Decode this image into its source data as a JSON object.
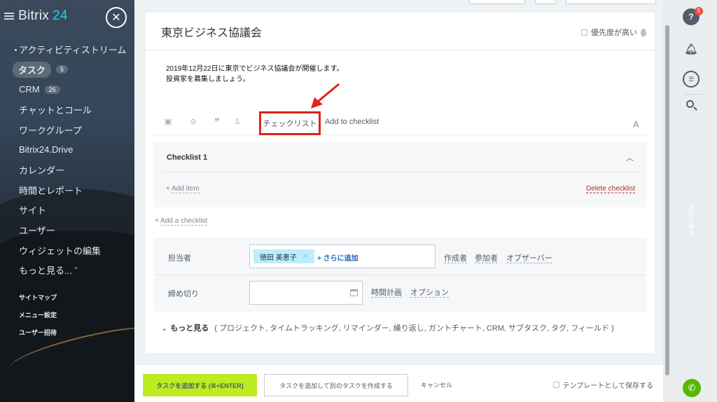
{
  "sidebar": {
    "logo_text": "Bitrix",
    "logo_num": "24",
    "close_glyph": "✕",
    "items": [
      {
        "label": "アクティビティストリーム"
      },
      {
        "label": "タスク",
        "count": "5"
      },
      {
        "label": "CRM",
        "count": "26"
      },
      {
        "label": "チャットとコール"
      },
      {
        "label": "ワークグループ"
      },
      {
        "label": "Bitrix24.Drive"
      },
      {
        "label": "カレンダー"
      },
      {
        "label": "時間とレポート"
      },
      {
        "label": "サイト"
      },
      {
        "label": "ユーザー"
      },
      {
        "label": "ウィジェットの編集"
      },
      {
        "label": "もっと見る... ˇ"
      }
    ],
    "footer_links": [
      "サイトマップ",
      "メニュー設定",
      "ユーザー招待"
    ]
  },
  "task": {
    "title": "東京ビジネス協議会",
    "priority_label": "優先度が高い",
    "description_line1": "2019年12月22日に東京でビジネス協議会が開催します。",
    "description_line2": "投資家を募集しましょう。"
  },
  "toolbar": {
    "checklist_label": "チェックリスト",
    "add_to_checklist": "Add to checklist",
    "font_glyph": "A",
    "icons": [
      "video-icon",
      "link-icon",
      "quote-icon",
      "user-mention-icon"
    ]
  },
  "checklist": {
    "title": "Checklist 1",
    "add_item": "Add item",
    "delete": "Delete checklist",
    "add_checklist": "Add a checklist"
  },
  "fields": {
    "assignee_label": "担当者",
    "assignee_user": "徳田 美恵子",
    "add_more": "+ さらに追加",
    "roles": [
      "作成者",
      "参加者",
      "オブザーバー"
    ],
    "deadline_label": "締め切り",
    "deadline_value": "",
    "time_planning": "時間計画",
    "options": "オプション"
  },
  "more": {
    "label": "もっと見る",
    "items": "( プロジェクト, タイムトラッキング, リマインダー, 繰り返し, ガントチャート, CRM, サブタスク, タグ, フィールド )"
  },
  "bottom": {
    "add_task": "タスクを追加する (⌘+ENTER)",
    "add_and_create": "タスクを追加して別のタスクを作成する",
    "cancel": "キャンセル",
    "save_template": "テンプレートとして保存する"
  },
  "right_panel": {
    "help_glyph": "?",
    "help_badge": "5",
    "vertical_text": "会話を開始"
  },
  "colors": {
    "accent_blue": "#2fc6f6",
    "primary_button": "#bbed21",
    "highlight_red": "#e0221c",
    "delete_red": "#c42a26",
    "call_green": "#55b800"
  }
}
